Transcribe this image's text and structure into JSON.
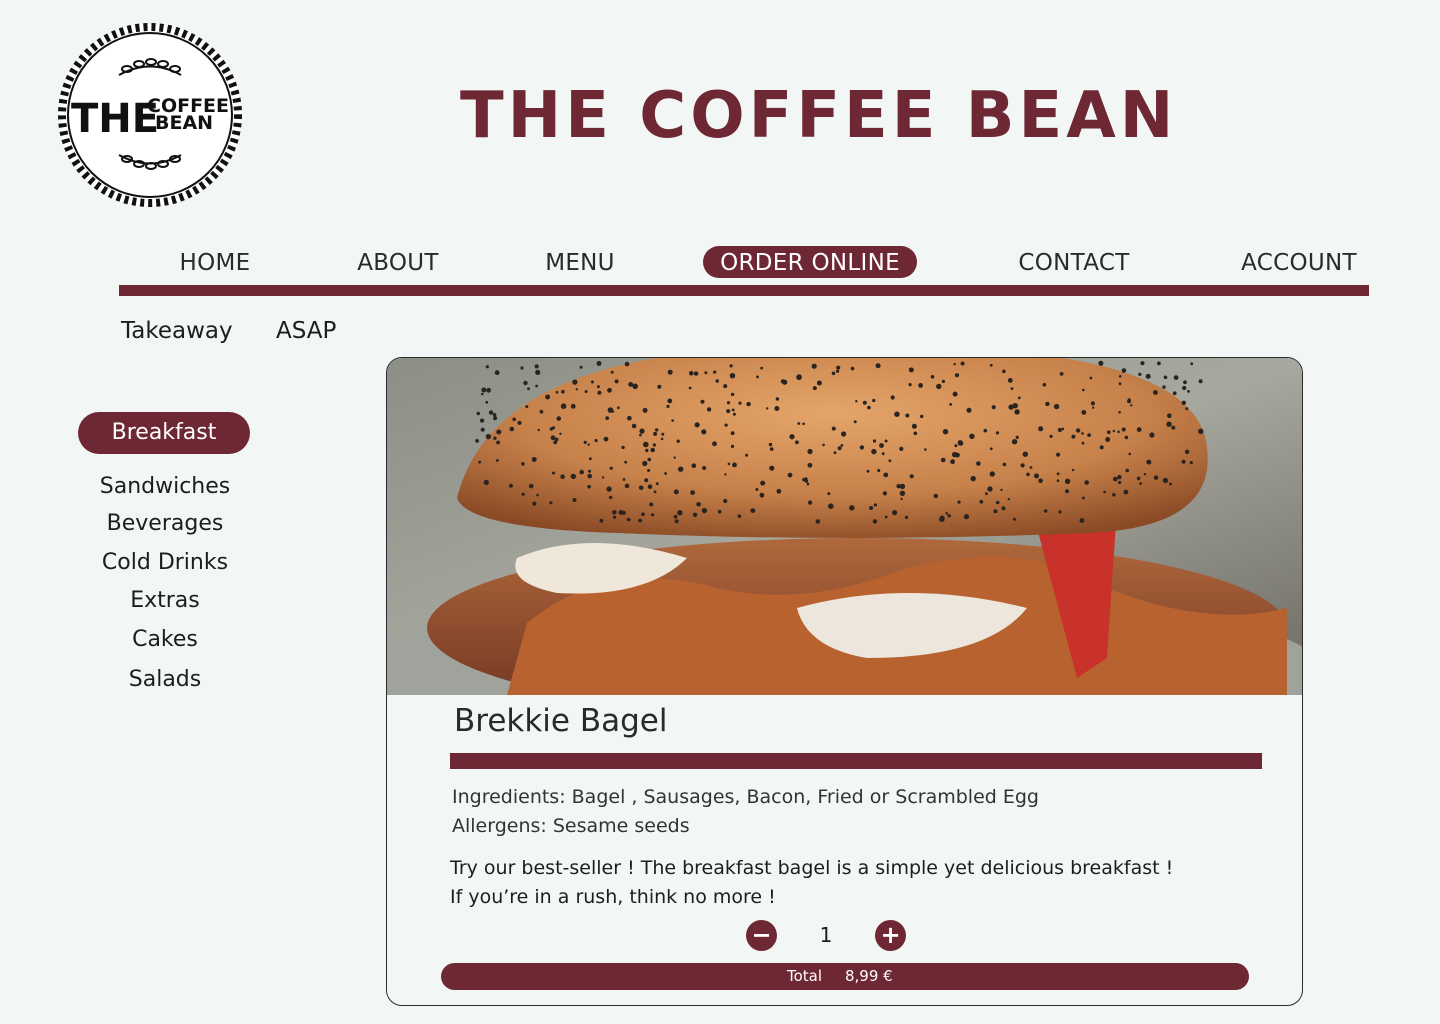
{
  "brand": {
    "logo_the": "THE",
    "logo_coffee": "COFFEE",
    "logo_bean": "BEAN",
    "title": "THE COFFEE BEAN",
    "accent_color": "#6e2834"
  },
  "nav": {
    "items": [
      {
        "label": "HOME",
        "active": false
      },
      {
        "label": "ABOUT",
        "active": false
      },
      {
        "label": "MENU",
        "active": false
      },
      {
        "label": "ORDER ONLINE",
        "active": true
      },
      {
        "label": "CONTACT",
        "active": false
      },
      {
        "label": "ACCOUNT",
        "active": false
      }
    ]
  },
  "order_options": {
    "mode": "Takeaway",
    "timing": "ASAP"
  },
  "categories": {
    "active": "Breakfast",
    "items": [
      "Sandwiches",
      "Beverages",
      "Cold Drinks",
      "Extras",
      "Cakes",
      "Salads"
    ]
  },
  "product": {
    "image": "bagel-photo",
    "name": "Brekkie Bagel",
    "ingredients": "Ingredients: Bagel , Sausages, Bacon, Fried or Scrambled Egg",
    "allergens": "Allergens: Sesame seeds",
    "description_line1": "Try our best-seller ! The breakfast bagel is a simple yet delicious breakfast !",
    "description_line2": "If you’re in a rush, think no more !",
    "quantity": "1",
    "decrement_icon": "minus-icon",
    "increment_icon": "plus-icon",
    "total_label": "Total",
    "total_value": "8,99 €"
  }
}
